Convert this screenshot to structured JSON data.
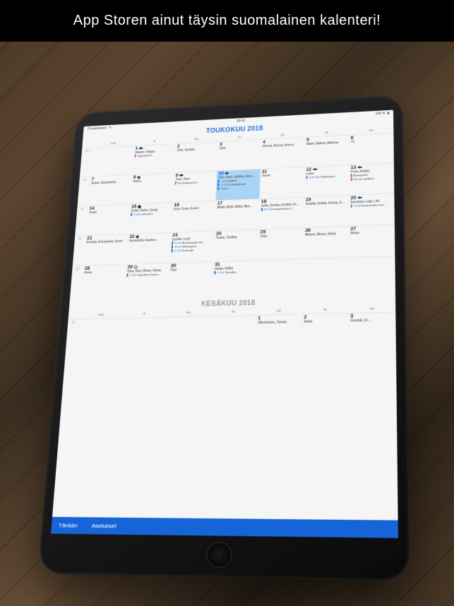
{
  "caption": "App Storen ainut täysin suomalainen kalenteri!",
  "status": {
    "leftApp": "iTunesKortteri",
    "time": "15:43",
    "battery": "100 %",
    "wifi": "wifi-icon"
  },
  "month1": {
    "title": "TOUKOKUU 2018",
    "weekdays": [
      "ma",
      "ti",
      "ke",
      "to",
      "pe",
      "la",
      "su"
    ],
    "weeks": [
      {
        "wk": 18,
        "days": [
          {
            "empty": true
          },
          {
            "num": 1,
            "names": "Valpuri, Vappu",
            "flag": true,
            "events": [
              {
                "text": "vappupäivät",
                "color": "pink"
              }
            ]
          },
          {
            "num": 2,
            "names": "Vilvi, Vuokko"
          },
          {
            "num": 3,
            "names": "Outi"
          },
          {
            "num": 4,
            "names": "Roosa, Ruusa, Ruusu"
          },
          {
            "num": 5,
            "names": "Maini, Malina, Mellssa"
          },
          {
            "num": 6,
            "names": "Yli"
          }
        ]
      },
      {
        "wk": 19,
        "days": [
          {
            "num": 7,
            "names": "Helmi, Kastehelmi"
          },
          {
            "num": 8,
            "names": "Heino",
            "moon": "q3"
          },
          {
            "num": 9,
            "names": "Timi, Timo",
            "flag": true,
            "events": [
              {
                "text": "Eurooppa-päivä",
                "color": "pink"
              }
            ]
          },
          {
            "num": 10,
            "names": "Aini, Aino, Ainikki, Aino…",
            "flag": true,
            "today": true,
            "events": [
              {
                "tm": "1:00",
                "text": "Untitled"
              },
              {
                "tm": "11:00",
                "text": "Testitapahtum"
              },
              {
                "text": "Testi 2"
              }
            ]
          },
          {
            "num": 11,
            "names": "Osmo"
          },
          {
            "num": 12,
            "names": "Lotta",
            "flag": true,
            "events": [
              {
                "tm": "2:00",
                "text": "J.V. Snellmanin…",
                "color": "pink"
              }
            ]
          },
          {
            "num": 13,
            "names": "Fiora, Kukka",
            "flag": true,
            "events": [
              {
                "text": "Äitienpäivä",
                "color": "pink"
              },
              {
                "text": "äiti aäi: synttärit",
                "color": "pink"
              }
            ]
          }
        ]
      },
      {
        "wk": 20,
        "days": [
          {
            "num": 14,
            "names": "Tuula"
          },
          {
            "num": 15,
            "names": "Sofia, Sohvi, Sonja",
            "moon": "new",
            "events": [
              {
                "tm": "13:00",
                "text": "Lääkärikä"
              }
            ]
          },
          {
            "num": 16,
            "names": "Essi, Ester, Esteri"
          },
          {
            "num": 17,
            "names": "Maila, Malli, Maila, Mai…"
          },
          {
            "num": 18,
            "names": "Uuko, Eerika, Eerikki, Er…",
            "events": [
              {
                "tm": "8:00",
                "text": "Testitapahtumo 2"
              }
            ]
          },
          {
            "num": 19,
            "names": "Amalia, Emilia, Emma, E…"
          },
          {
            "num": 20,
            "names": "Karoliina, Lilja, Lilli",
            "flag": true,
            "events": [
              {
                "tm": "13:00",
                "text": "Kaatuneiden mui…",
                "color": "pink"
              }
            ]
          }
        ]
      },
      {
        "wk": 21,
        "days": [
          {
            "num": 21,
            "names": "Konsta, Konstantin, Kosti"
          },
          {
            "num": 22,
            "names": "Hemminki, Hemmo",
            "moon": "q1"
          },
          {
            "num": 23,
            "names": "Lyydla, Lyyli",
            "events": [
              {
                "tm": "12:00",
                "text": "Asiakaspalaverit"
              },
              {
                "tm": "14:00",
                "text": "Helsingissä"
              },
              {
                "tm": "17:00",
                "text": "Vantaalla"
              }
            ]
          },
          {
            "num": 24,
            "names": "Tuuka, Tuukka"
          },
          {
            "num": 25,
            "names": "Urpo"
          },
          {
            "num": 26,
            "names": "Mimmi, Minna, Vilma"
          },
          {
            "num": 27,
            "names": "Riitva"
          }
        ]
      },
      {
        "wk": 22,
        "days": [
          {
            "num": 28,
            "names": "Alma"
          },
          {
            "num": 29,
            "names": "Oiva, Oivi, Oliver, Olivia",
            "moon": "full",
            "events": [
              {
                "tm": "22:00",
                "text": "Täysikuun koirav…"
              }
            ]
          },
          {
            "num": 30,
            "names": "Pasi"
          },
          {
            "num": 31,
            "names": "Helga, Helka",
            "events": [
              {
                "tm": "12:00",
                "text": "Testallus"
              }
            ]
          },
          {
            "empty": true
          },
          {
            "empty": true
          },
          {
            "empty": true
          }
        ]
      }
    ]
  },
  "month2": {
    "title": "KESÄKUU 2018",
    "weekdays": [
      "ma",
      "ti",
      "ke",
      "to",
      "pe",
      "la",
      "su"
    ],
    "week": {
      "wk": 22,
      "days": [
        {
          "empty": true
        },
        {
          "empty": true
        },
        {
          "empty": true
        },
        {
          "empty": true
        },
        {
          "num": 1,
          "names": "Nikodemus, Teemu"
        },
        {
          "num": 2,
          "names": "Venla"
        },
        {
          "num": 3,
          "names": "Orvokki, Vi…"
        }
      ]
    }
  },
  "toolbar": {
    "today": "Tänään",
    "settings": "Asetukset"
  }
}
